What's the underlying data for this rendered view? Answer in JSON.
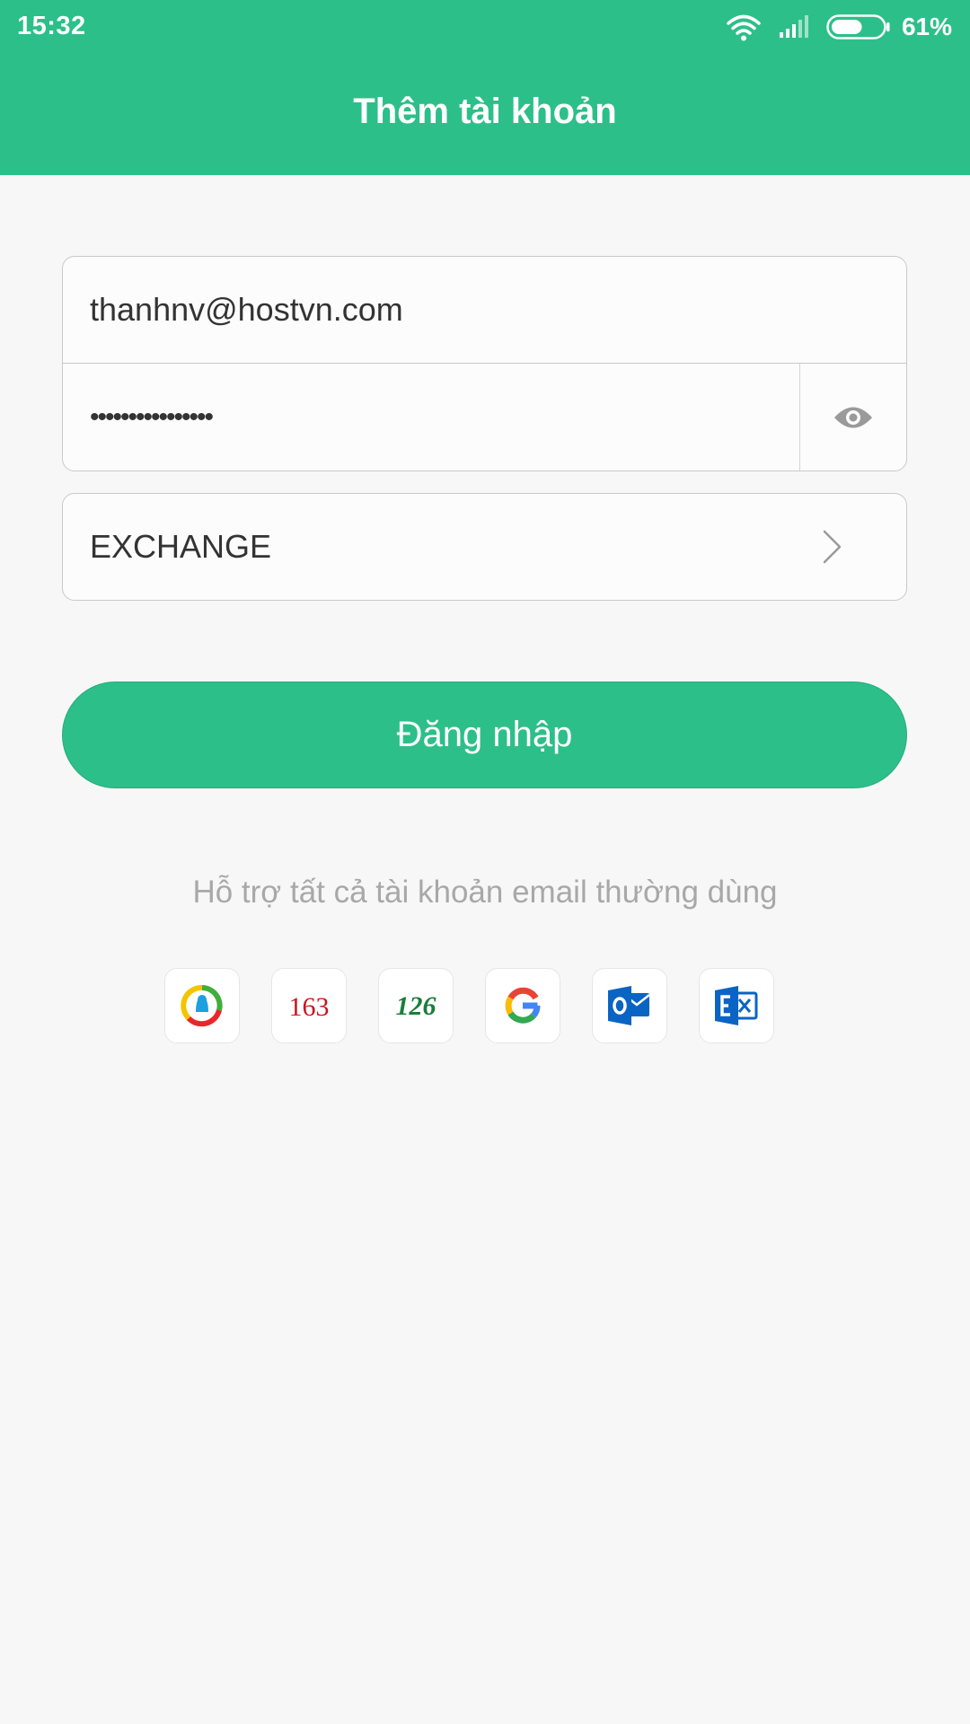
{
  "status_bar": {
    "time": "15:32",
    "battery_percent": "61%",
    "battery_level": 0.61,
    "icons": [
      "wifi-icon",
      "signal-icon",
      "battery-icon"
    ]
  },
  "header": {
    "title": "Thêm tài khoản"
  },
  "form": {
    "email_value": "thanhnv@hostvn.com",
    "password_mask": "••••••••••••••••",
    "server_type": "EXCHANGE"
  },
  "login_button_label": "Đăng nhập",
  "support_text": "Hỗ trợ tất cả tài khoản email thường dùng",
  "providers": [
    {
      "name": "qq-mail",
      "icon": "qq-mail-icon"
    },
    {
      "name": "163",
      "label": "163",
      "icon": "163-mail-icon"
    },
    {
      "name": "126",
      "label": "126",
      "icon": "126-mail-icon"
    },
    {
      "name": "google",
      "icon": "google-icon"
    },
    {
      "name": "outlook",
      "icon": "outlook-icon"
    },
    {
      "name": "exchange",
      "icon": "exchange-icon"
    }
  ],
  "colors": {
    "accent": "#2cbf8a",
    "background": "#f7f7f7",
    "text": "#333333",
    "muted_text": "#a8a8a8",
    "border": "#c9c9c9",
    "mail163_red": "#c8161d",
    "mail126_green": "#1a7d3a",
    "microsoft_blue": "#0a64c4"
  }
}
